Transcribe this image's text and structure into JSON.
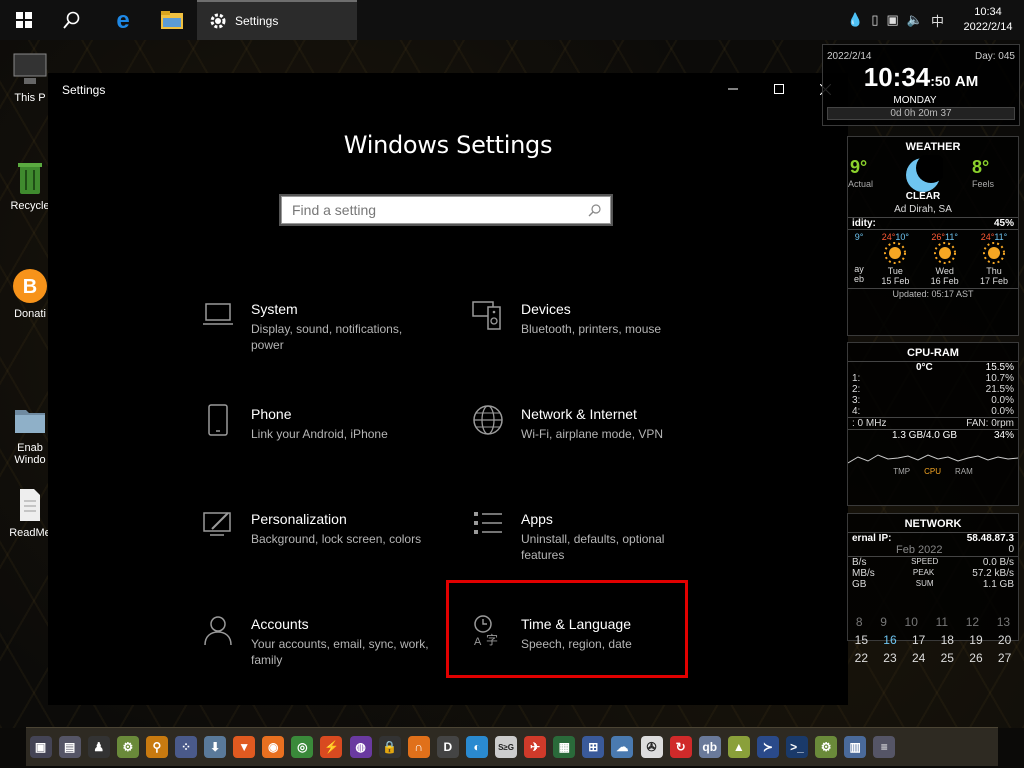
{
  "taskbar": {
    "active_window_label": "Settings",
    "tray_input_language": "中",
    "clock_time": "10:34",
    "clock_date": "2022/2/14"
  },
  "desktop_icons": [
    {
      "label": "This P",
      "icon": "monitor-icon"
    },
    {
      "label": "Recycle",
      "icon": "recycle-bin-icon"
    },
    {
      "label": "Donati",
      "icon": "bitcoin-icon"
    },
    {
      "label": "Enab\nWindo",
      "icon": "folder-icon"
    },
    {
      "label": "ReadMe",
      "icon": "document-icon"
    }
  ],
  "window": {
    "title": "Settings",
    "heading": "Windows Settings",
    "search_placeholder": "Find a setting",
    "tiles": [
      {
        "name": "System",
        "desc": "Display, sound, notifications, power",
        "icon": "laptop-icon"
      },
      {
        "name": "Devices",
        "desc": "Bluetooth, printers, mouse",
        "icon": "keyboard-speaker-icon"
      },
      {
        "name": "Phone",
        "desc": "Link your Android, iPhone",
        "icon": "phone-icon"
      },
      {
        "name": "Network & Internet",
        "desc": "Wi-Fi, airplane mode, VPN",
        "icon": "globe-icon"
      },
      {
        "name": "Personalization",
        "desc": "Background, lock screen, colors",
        "icon": "paint-icon"
      },
      {
        "name": "Apps",
        "desc": "Uninstall, defaults, optional features",
        "icon": "apps-list-icon"
      },
      {
        "name": "Accounts",
        "desc": "Your accounts, email, sync, work, family",
        "icon": "person-icon"
      },
      {
        "name": "Time & Language",
        "desc": "Speech, region, date",
        "icon": "time-language-icon"
      }
    ]
  },
  "time_widget": {
    "date": "2022/2/14",
    "day_of_year": "Day: 045",
    "time": "10:34",
    "seconds": ":50",
    "ampm": "AM",
    "weekday": "MONDAY",
    "uptime": "0d 0h 20m 37"
  },
  "weather_widget": {
    "title": "WEATHER",
    "actual_temp": "9°",
    "actual_label": "Actual",
    "feels_temp": "8°",
    "feels_label": "Feels",
    "condition": "CLEAR",
    "location": "Ad Dirah, SA",
    "humidity_label": "idity:",
    "humidity_value": "45%",
    "forecast": [
      {
        "hi": "",
        "lo": "9°",
        "day": "ay",
        "date": "eb"
      },
      {
        "hi": "24°",
        "lo": "10°",
        "day": "Tue",
        "date": "15 Feb"
      },
      {
        "hi": "26°",
        "lo": "11°",
        "day": "Wed",
        "date": "16 Feb"
      },
      {
        "hi": "24°",
        "lo": "11°",
        "day": "Thu",
        "date": "17 Feb"
      }
    ],
    "updated": "Updated: 05:17 AST"
  },
  "cpu_widget": {
    "title": "CPU-RAM",
    "temp": "0°C",
    "total": "15.5%",
    "cores": [
      {
        "label": "1:",
        "value": "10.7%"
      },
      {
        "label": "2:",
        "value": "21.5%"
      },
      {
        "label": "3:",
        "value": "0.0%"
      },
      {
        "label": "4:",
        "value": "0.0%"
      }
    ],
    "freq": ": 0 MHz",
    "fan": "FAN: 0rpm",
    "ram": "1.3 GB/4.0 GB",
    "ram_pct": "34%",
    "graph_legend": [
      "TMP",
      "CPU",
      "RAM"
    ]
  },
  "network_widget": {
    "title": "NETWORK",
    "ip_label": "ernal IP:",
    "ip": "58.48.87.3",
    "month": "Feb 2022",
    "month_value": "0",
    "rows": [
      {
        "left": "B/s",
        "mid": "SPEED",
        "right": "0.0 B/s"
      },
      {
        "left": "MB/s",
        "mid": "PEAK",
        "right": "57.2 kB/s"
      },
      {
        "left": "GB",
        "mid": "SUM",
        "right": "1.1 GB"
      }
    ]
  },
  "calendar": {
    "rows": [
      [
        "8",
        "9",
        "10",
        "11",
        "12",
        "13"
      ],
      [
        "15",
        "16",
        "17",
        "18",
        "19",
        "20"
      ],
      [
        "22",
        "23",
        "24",
        "25",
        "26",
        "27"
      ],
      [
        "",
        "",
        "",
        "",
        "",
        ""
      ]
    ]
  },
  "colors": {
    "accent_red": "#e10000",
    "window_bg": "#000000",
    "weather_green": "#8bd12c",
    "weather_hot": "#ff5a36"
  }
}
